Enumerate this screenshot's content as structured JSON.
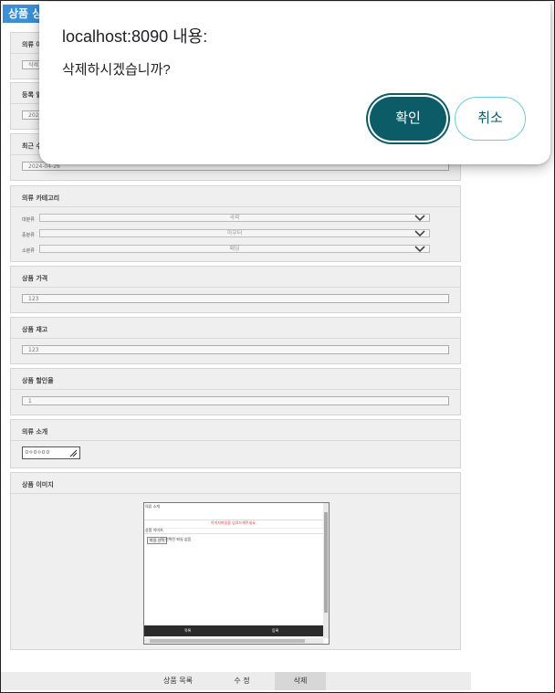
{
  "page": {
    "title": "상품 상"
  },
  "sections": {
    "name": {
      "label": "의류 이",
      "value": "삭제"
    },
    "reg_date": {
      "label": "등록 일",
      "value": "2024-"
    },
    "mod_date": {
      "label": "최근 수",
      "value": "2024-04-26"
    },
    "category": {
      "label": "의류 카테고리",
      "rows": [
        {
          "label": "대분류",
          "value": "국외"
        },
        {
          "label": "중분류",
          "value": "아우터"
        },
        {
          "label": "소분류",
          "value": "패딩"
        }
      ]
    },
    "price": {
      "label": "상품 가격",
      "value": "123"
    },
    "stock": {
      "label": "상품 재고",
      "value": "123"
    },
    "discount": {
      "label": "상품 할인율",
      "value": "1"
    },
    "intro": {
      "label": "의류 소개",
      "value": "ㅁㅇㅁㅇㅁㅁ"
    },
    "image": {
      "label": "상품 이미지",
      "preview": {
        "header": "의류 소개",
        "warning": "이미지파일을 업로드해주세요.",
        "subtitle": "상품 이미지",
        "file_button": "파일 선택",
        "file_status": "선택된 파일 없음",
        "left_button": "목록",
        "right_button": "등록"
      }
    }
  },
  "footer": {
    "list_label": "상품 목록",
    "edit_label": "수 정",
    "delete_label": "삭제"
  },
  "dialog": {
    "origin": "localhost:8090 내용:",
    "message": "삭제하시겠습니까?",
    "ok_label": "확인",
    "cancel_label": "취소"
  },
  "colors": {
    "accent": "#0b5c67",
    "title_bar": "#3a8fd6",
    "cancel_border": "#6fcad6"
  }
}
